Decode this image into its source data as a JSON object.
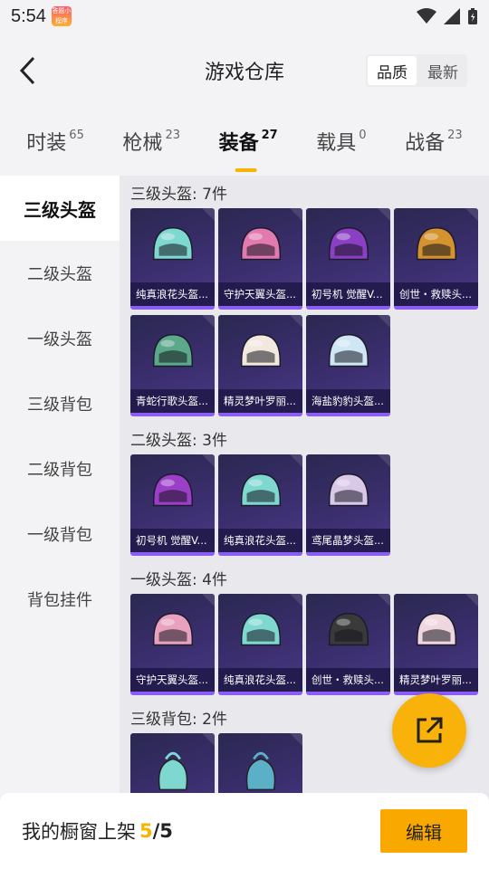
{
  "status_bar": {
    "time": "5:54",
    "badge_text": "答题小程序"
  },
  "header": {
    "title": "游戏仓库",
    "sort_options": [
      "品质",
      "最新"
    ],
    "active_sort": "品质"
  },
  "tabs": [
    {
      "label": "时装",
      "count": "65"
    },
    {
      "label": "枪械",
      "count": "23"
    },
    {
      "label": "装备",
      "count": "27"
    },
    {
      "label": "载具",
      "count": "0"
    },
    {
      "label": "战备",
      "count": "23"
    }
  ],
  "sidebar": [
    "三级头盔",
    "二级头盔",
    "一级头盔",
    "三级背包",
    "二级背包",
    "一级背包",
    "背包挂件"
  ],
  "sections": [
    {
      "title": "三级头盔: 7件",
      "items": [
        {
          "name": "纯真浪花头盔...",
          "icon": "level3-helmet-icon",
          "color": "#7fd8d0"
        },
        {
          "name": "守护天翼头盔...",
          "icon": "level3-helmet-icon",
          "color": "#e27ab0"
        },
        {
          "name": "初号机 觉醒V...",
          "icon": "level3-helmet-icon",
          "color": "#8a3fc4"
        },
        {
          "name": "创世・救赎头...",
          "icon": "level3-helmet-icon",
          "color": "#d4932f"
        },
        {
          "name": "青蛇行歌头盔...",
          "icon": "level3-helmet-icon",
          "color": "#5ba88a"
        },
        {
          "name": "精灵梦叶罗丽...",
          "icon": "level3-helmet-icon",
          "color": "#f2e8df"
        },
        {
          "name": "海盐豹豹头盔...",
          "icon": "level3-helmet-icon",
          "color": "#cfe6f5"
        }
      ]
    },
    {
      "title": "二级头盔: 3件",
      "items": [
        {
          "name": "初号机 觉醒V...",
          "icon": "level2-helmet-icon",
          "color": "#9b3fc8"
        },
        {
          "name": "纯真浪花头盔...",
          "icon": "level2-helmet-icon",
          "color": "#7fd8d0"
        },
        {
          "name": "鸢尾晶梦头盔...",
          "icon": "level2-helmet-icon",
          "color": "#d9c8e8"
        }
      ]
    },
    {
      "title": "一级头盔: 4件",
      "items": [
        {
          "name": "守护天翼头盔...",
          "icon": "level1-helmet-icon",
          "color": "#e8a2c0"
        },
        {
          "name": "纯真浪花头盔...",
          "icon": "level1-helmet-icon",
          "color": "#7fd8d0"
        },
        {
          "name": "创世・救赎头...",
          "icon": "level1-helmet-icon",
          "color": "#3a3a3a"
        },
        {
          "name": "精灵梦叶罗丽...",
          "icon": "level1-helmet-icon",
          "color": "#f0d6de"
        }
      ]
    },
    {
      "title": "三级背包: 2件",
      "items": [
        {
          "name": "",
          "icon": "level3-backpack-icon",
          "color": "#7fd8d0"
        },
        {
          "name": "",
          "icon": "level3-backpack-icon",
          "color": "#5bb0c8"
        }
      ]
    }
  ],
  "bottom_bar": {
    "shelf_label": "我的橱窗上架",
    "shelf_current": "5",
    "shelf_total": "/5",
    "edit_label": "编辑"
  },
  "colors": {
    "accent": "#f7b500",
    "card_bg": "#3b2e6e",
    "card_border": "#8b5cf6"
  }
}
